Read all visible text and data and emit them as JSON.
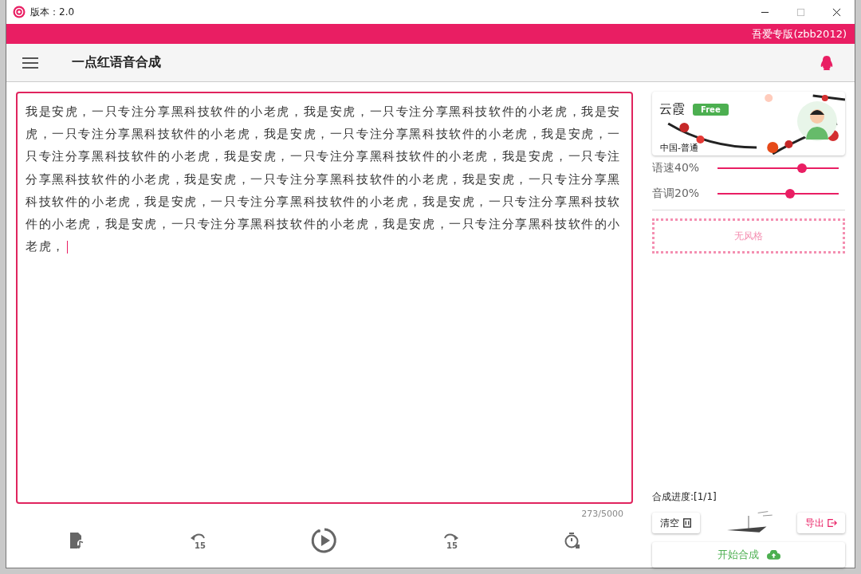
{
  "window": {
    "title": "版本：2.0"
  },
  "banner": {
    "text": "吾爱专版(zbb2012)"
  },
  "toolbar": {
    "title": "一点红语音合成"
  },
  "editor": {
    "text": "我是安虎，一只专注分享黑科技软件的小老虎，我是安虎，一只专注分享黑科技软件的小老虎，我是安虎，一只专注分享黑科技软件的小老虎，我是安虎，一只专注分享黑科技软件的小老虎，我是安虎，一只专注分享黑科技软件的小老虎，我是安虎，一只专注分享黑科技软件的小老虎，我是安虎，一只专注分享黑科技软件的小老虎，我是安虎，一只专注分享黑科技软件的小老虎，我是安虎，一只专注分享黑科技软件的小老虎，我是安虎，一只专注分享黑科技软件的小老虎，我是安虎，一只专注分享黑科技软件的小老虎，我是安虎，一只专注分享黑科技软件的小老虎，我是安虎，一只专注分享黑科技软件的小老虎，",
    "count": "273/5000"
  },
  "voice": {
    "name": "云霞",
    "badge": "Free",
    "region": "中国-普通"
  },
  "sliders": [
    {
      "label": "语速40%",
      "level": 0.7
    },
    {
      "label": "音调20%",
      "level": 0.6
    }
  ],
  "style_box": {
    "text": "无风格"
  },
  "playback": {
    "rewind_label": "15",
    "forward_label": "15"
  },
  "progress": {
    "label": "合成进度:[1/1]"
  },
  "buttons": {
    "clear": "清空",
    "export": "导出",
    "start": "开始合成"
  }
}
